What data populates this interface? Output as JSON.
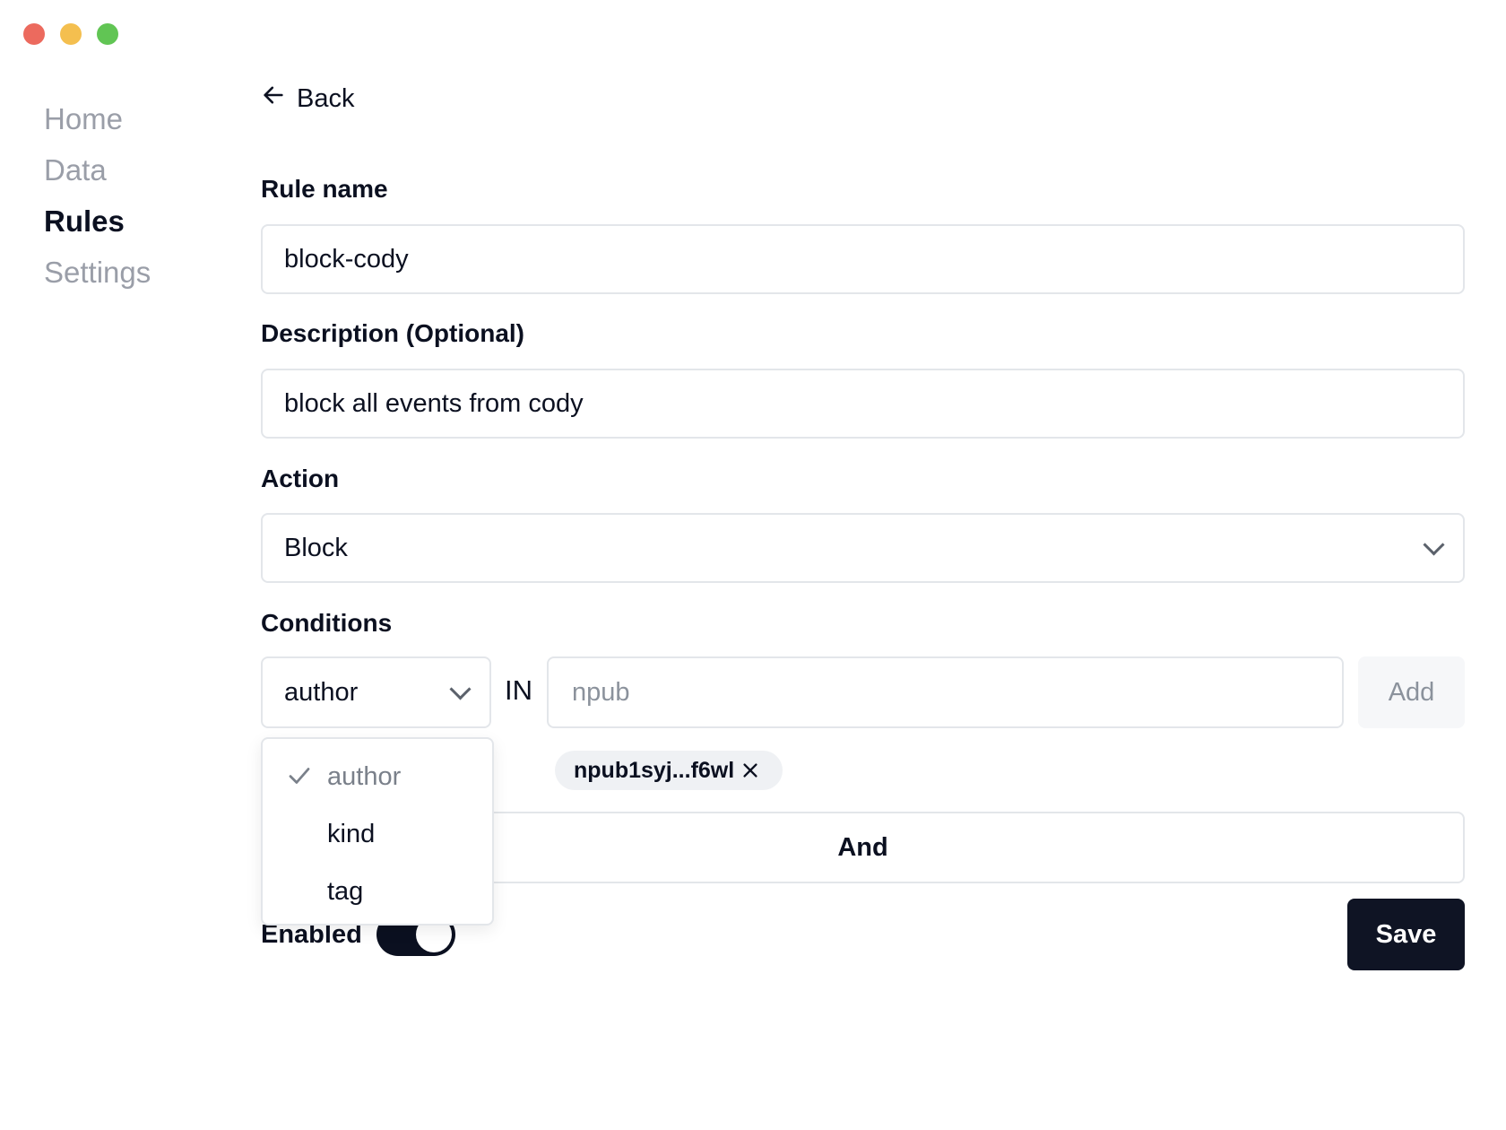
{
  "window": {
    "lights": [
      "#ec6a5e",
      "#f4bf4f",
      "#61c554"
    ]
  },
  "sidebar": {
    "items": [
      {
        "label": "Home",
        "active": false
      },
      {
        "label": "Data",
        "active": false
      },
      {
        "label": "Rules",
        "active": true
      },
      {
        "label": "Settings",
        "active": false
      }
    ]
  },
  "back": {
    "label": "Back"
  },
  "form": {
    "rule_name": {
      "label": "Rule name",
      "value": "block-cody"
    },
    "description": {
      "label": "Description (Optional)",
      "value": "block all events from cody"
    },
    "action": {
      "label": "Action",
      "value": "Block"
    },
    "conditions": {
      "label": "Conditions",
      "field_value": "author",
      "operator": "IN",
      "input_placeholder": "npub",
      "add_label": "Add",
      "chips": [
        "npub1syj...f6wl"
      ],
      "and_label": "And",
      "dropdown_options": [
        {
          "label": "author",
          "selected": true
        },
        {
          "label": "kind",
          "selected": false
        },
        {
          "label": "tag",
          "selected": false
        }
      ]
    },
    "enabled": {
      "label": "Enabled",
      "on": true
    },
    "save_label": "Save"
  },
  "colors": {
    "accent_dark": "#0f1424",
    "border": "#e3e6ea",
    "muted_text": "#9a9ea8"
  }
}
